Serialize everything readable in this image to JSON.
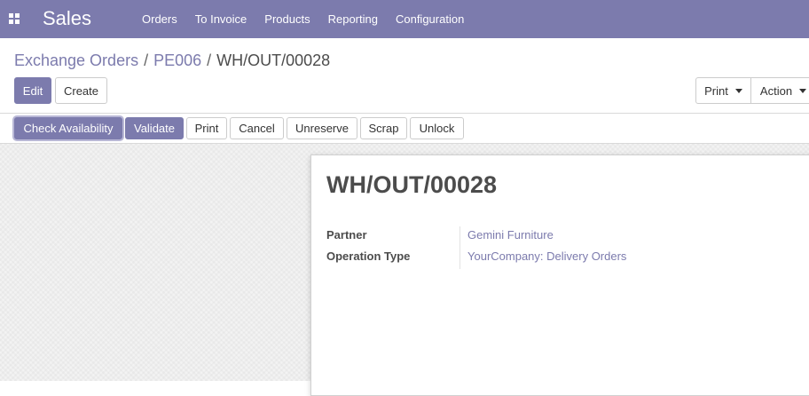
{
  "navbar": {
    "app_title": "Sales",
    "menu": [
      "Orders",
      "To Invoice",
      "Products",
      "Reporting",
      "Configuration"
    ]
  },
  "breadcrumb": {
    "items": [
      "Exchange Orders",
      "PE006"
    ],
    "current": "WH/OUT/00028"
  },
  "actions": {
    "edit": "Edit",
    "create": "Create",
    "print": "Print",
    "action": "Action"
  },
  "statusbar": {
    "buttons": [
      "Check Availability",
      "Validate",
      "Print",
      "Cancel",
      "Unreserve",
      "Scrap",
      "Unlock"
    ]
  },
  "form": {
    "name": "WH/OUT/00028",
    "fields": [
      {
        "label": "Partner",
        "value": "Gemini Furniture"
      },
      {
        "label": "Operation Type",
        "value": "YourCompany: Delivery Orders"
      }
    ]
  },
  "colors": {
    "brand": "#7c7bad",
    "text": "#4c4c4c"
  }
}
